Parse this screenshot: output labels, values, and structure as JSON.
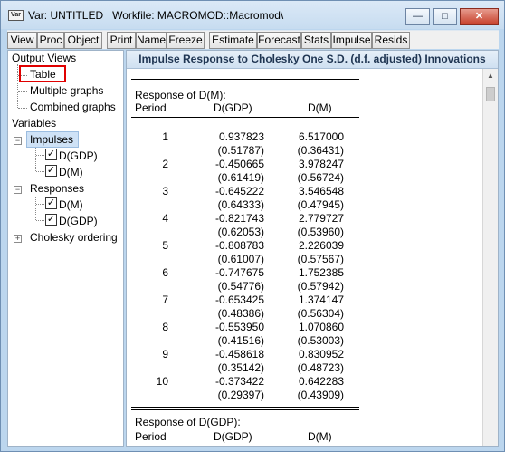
{
  "window": {
    "title": "Var: UNTITLED   Workfile: MACROMOD::Macromod\\",
    "app_icon_label": "Var"
  },
  "toolbar": {
    "buttons": [
      "View",
      "Proc",
      "Object",
      "Print",
      "Name",
      "Freeze",
      "Estimate",
      "Forecast",
      "Stats",
      "Impulse",
      "Resids"
    ]
  },
  "tree": {
    "output_views": "Output Views",
    "table": "Table",
    "multiple_graphs": "Multiple graphs",
    "combined_graphs": "Combined graphs",
    "variables": "Variables",
    "impulses": "Impulses",
    "impulse_items": [
      "D(GDP)",
      "D(M)"
    ],
    "responses": "Responses",
    "response_items": [
      "D(M)",
      "D(GDP)"
    ],
    "cholesky": "Cholesky ordering"
  },
  "table": {
    "header": "Impulse Response to Cholesky One S.D. (d.f. adjusted) Innovations",
    "section1_title": "Response of D(M):",
    "col_period": "Period",
    "col_a": "D(GDP)",
    "col_b": "D(M)",
    "rows": [
      {
        "period": "1",
        "a": "0.937823",
        "b": "6.517000",
        "a_se": "(0.51787)",
        "b_se": "(0.36431)"
      },
      {
        "period": "2",
        "a": "-0.450665",
        "b": "3.978247",
        "a_se": "(0.61419)",
        "b_se": "(0.56724)"
      },
      {
        "period": "3",
        "a": "-0.645222",
        "b": "3.546548",
        "a_se": "(0.64333)",
        "b_se": "(0.47945)"
      },
      {
        "period": "4",
        "a": "-0.821743",
        "b": "2.779727",
        "a_se": "(0.62053)",
        "b_se": "(0.53960)"
      },
      {
        "period": "5",
        "a": "-0.808783",
        "b": "2.226039",
        "a_se": "(0.61007)",
        "b_se": "(0.57567)"
      },
      {
        "period": "6",
        "a": "-0.747675",
        "b": "1.752385",
        "a_se": "(0.54776)",
        "b_se": "(0.57942)"
      },
      {
        "period": "7",
        "a": "-0.653425",
        "b": "1.374147",
        "a_se": "(0.48386)",
        "b_se": "(0.56304)"
      },
      {
        "period": "8",
        "a": "-0.553950",
        "b": "1.070860",
        "a_se": "(0.41516)",
        "b_se": "(0.53003)"
      },
      {
        "period": "9",
        "a": "-0.458618",
        "b": "0.830952",
        "a_se": "(0.35142)",
        "b_se": "(0.48723)"
      },
      {
        "period": "10",
        "a": "-0.373422",
        "b": "0.642283",
        "a_se": "(0.29397)",
        "b_se": "(0.43909)"
      }
    ],
    "section2_title": "Response of D(GDP):",
    "col_period2": "Period",
    "col_a2": "D(GDP)",
    "col_b2": "D(M)"
  }
}
